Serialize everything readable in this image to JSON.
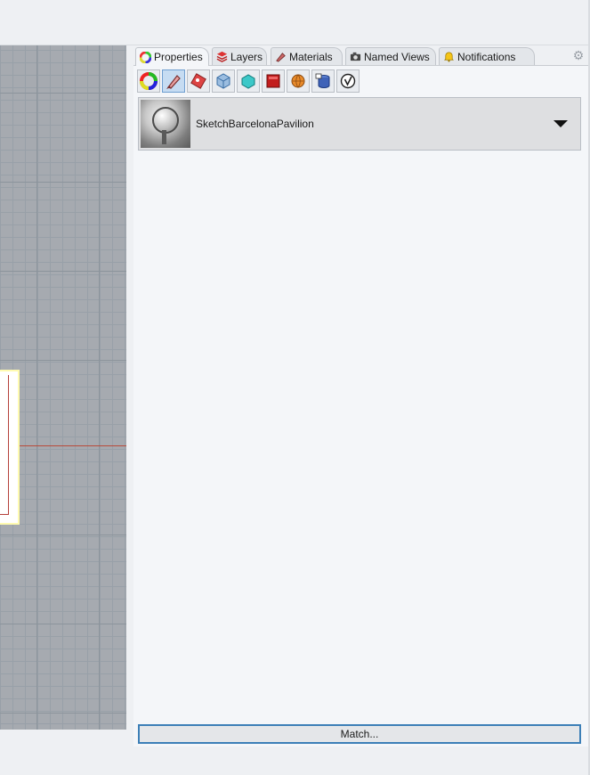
{
  "panel": {
    "tabs": [
      {
        "label": "Properties",
        "icon": "color-wheel-icon",
        "active": true
      },
      {
        "label": "Layers",
        "icon": "layers-icon",
        "active": false
      },
      {
        "label": "Materials",
        "icon": "materials-icon",
        "active": false
      },
      {
        "label": "Named Views",
        "icon": "camera-icon",
        "active": false
      },
      {
        "label": "Notifications",
        "icon": "bell-icon",
        "active": false
      }
    ],
    "toolbar_icons": [
      "object-color-icon",
      "material-brush-icon",
      "decal-icon",
      "mapping-icon",
      "shape-icon",
      "texture-icon",
      "environment-icon",
      "database-icon",
      "vray-icon"
    ],
    "selected_toolbar_icon": "material-brush-icon",
    "material": {
      "name": "SketchBarcelonaPavilion",
      "thumbnail_icon": "material-preview-icon"
    },
    "match_label": "Match..."
  },
  "colors": {
    "accent": "#3c7fb7",
    "axis_red": "#b94a3a",
    "grid": "#a6aab0"
  }
}
